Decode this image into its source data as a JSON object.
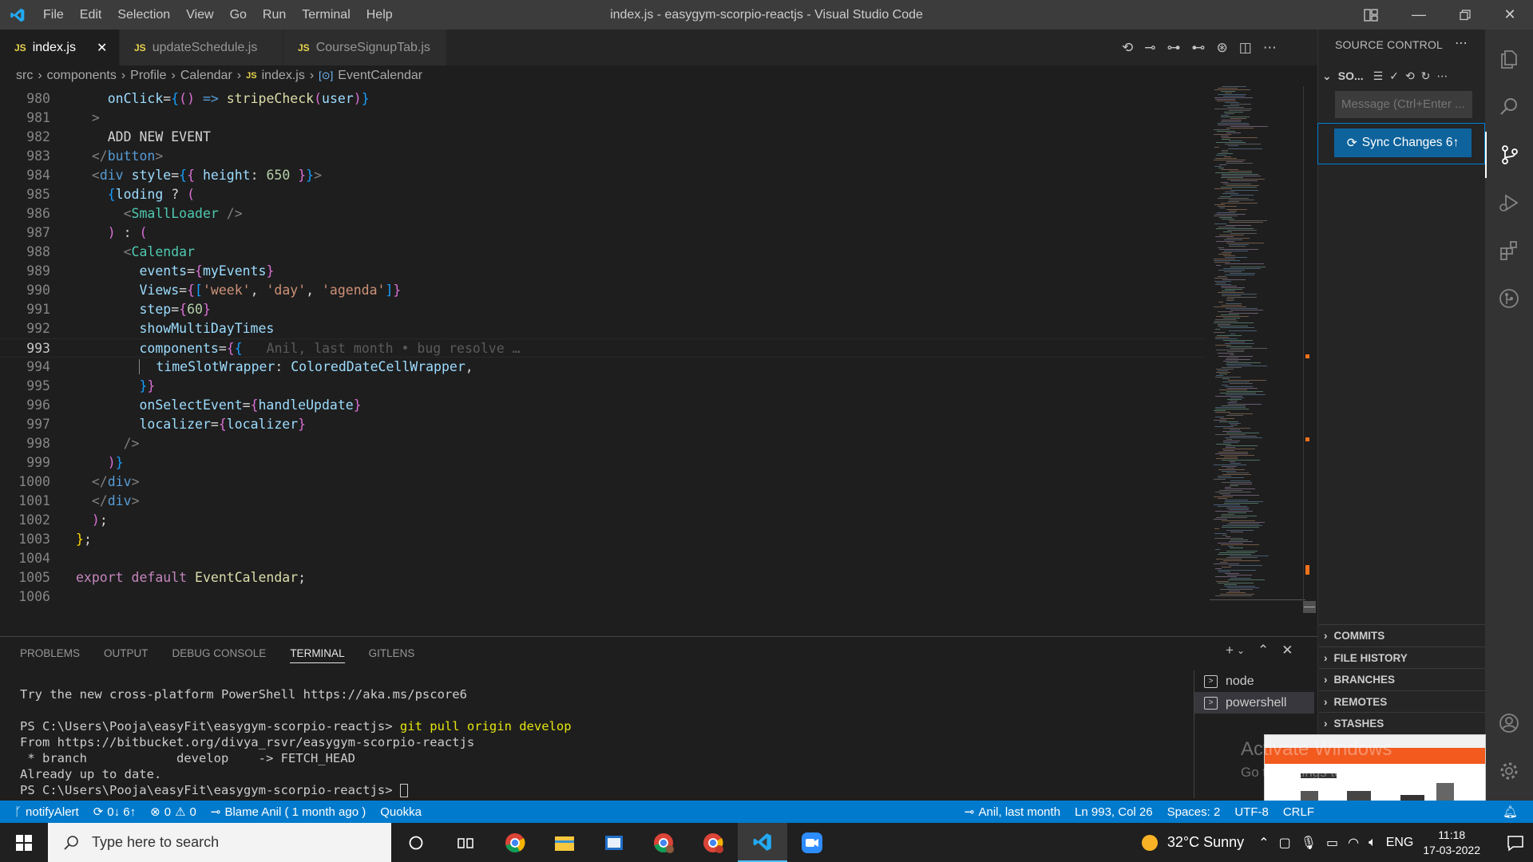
{
  "window": {
    "title": "index.js - easygym-scorpio-reactjs - Visual Studio Code",
    "menu": [
      "File",
      "Edit",
      "Selection",
      "View",
      "Go",
      "Run",
      "Terminal",
      "Help"
    ]
  },
  "tabs": [
    {
      "icon": "JS",
      "label": "index.js",
      "active": true
    },
    {
      "icon": "JS",
      "label": "updateSchedule.js",
      "active": false
    },
    {
      "icon": "JS",
      "label": "CourseSignupTab.js",
      "active": false
    }
  ],
  "breadcrumb": {
    "items": [
      "src",
      "components",
      "Profile",
      "Calendar"
    ],
    "file": "index.js",
    "symbol": "EventCalendar"
  },
  "editor": {
    "current_line": 993,
    "blame_inline": "Anil, last month • bug resolve …",
    "line_numbers": [
      "980",
      "981",
      "982",
      "983",
      "984",
      "985",
      "986",
      "987",
      "988",
      "989",
      "990",
      "991",
      "992",
      "993",
      "994",
      "995",
      "996",
      "997",
      "998",
      "999",
      "1000",
      "1001",
      "1002",
      "1003",
      "1004",
      "1005",
      "1006"
    ]
  },
  "panel": {
    "tabs": [
      "PROBLEMS",
      "OUTPUT",
      "DEBUG CONSOLE",
      "TERMINAL",
      "GITLENS"
    ],
    "active_tab": "TERMINAL",
    "terminal_lines": {
      "l1": "Try the new cross-platform PowerShell https://aka.ms/pscore6",
      "l2_prompt": "PS C:\\Users\\Pooja\\easyFit\\easygym-scorpio-reactjs> ",
      "l2_cmd": "git pull origin develop",
      "l3": "From https://bitbucket.org/divya_rsvr/easygym-scorpio-reactjs",
      "l4": " * branch            develop    -> FETCH_HEAD",
      "l5": "Already up to date.",
      "l6_prompt": "PS C:\\Users\\Pooja\\easyFit\\easygym-scorpio-reactjs> "
    },
    "terminals": [
      "node",
      "powershell"
    ]
  },
  "source_control": {
    "title": "SOURCE CONTROL",
    "repo_label": "SO...",
    "message_placeholder": "Message (Ctrl+Enter ...",
    "sync_label": "Sync Changes 6↑",
    "sections": [
      "COMMITS",
      "FILE HISTORY",
      "BRANCHES",
      "REMOTES",
      "STASHES"
    ]
  },
  "overlay": {
    "activate_title": "Activate Windows",
    "activate_sub": "Go to Settings to activate Windows."
  },
  "statusbar": {
    "branch": "notifyAlert",
    "sync": "0↓ 6↑",
    "errors": "0",
    "warnings": "0",
    "blame": "Blame Anil ( 1 month ago )",
    "quokka": "Quokka",
    "author": "Anil, last month",
    "position": "Ln 993, Col 26",
    "spaces": "Spaces: 2",
    "encoding": "UTF-8",
    "eol": "CRLF"
  },
  "taskbar": {
    "search_placeholder": "Type here to search",
    "weather": "32°C  Sunny",
    "lang": "ENG",
    "time": "11:18",
    "date": "17-03-2022"
  },
  "colors": {
    "accent": "#007acc",
    "titlebar": "#3c3c3c",
    "editor_bg": "#1e1e1e",
    "sidebar_bg": "#252526"
  }
}
